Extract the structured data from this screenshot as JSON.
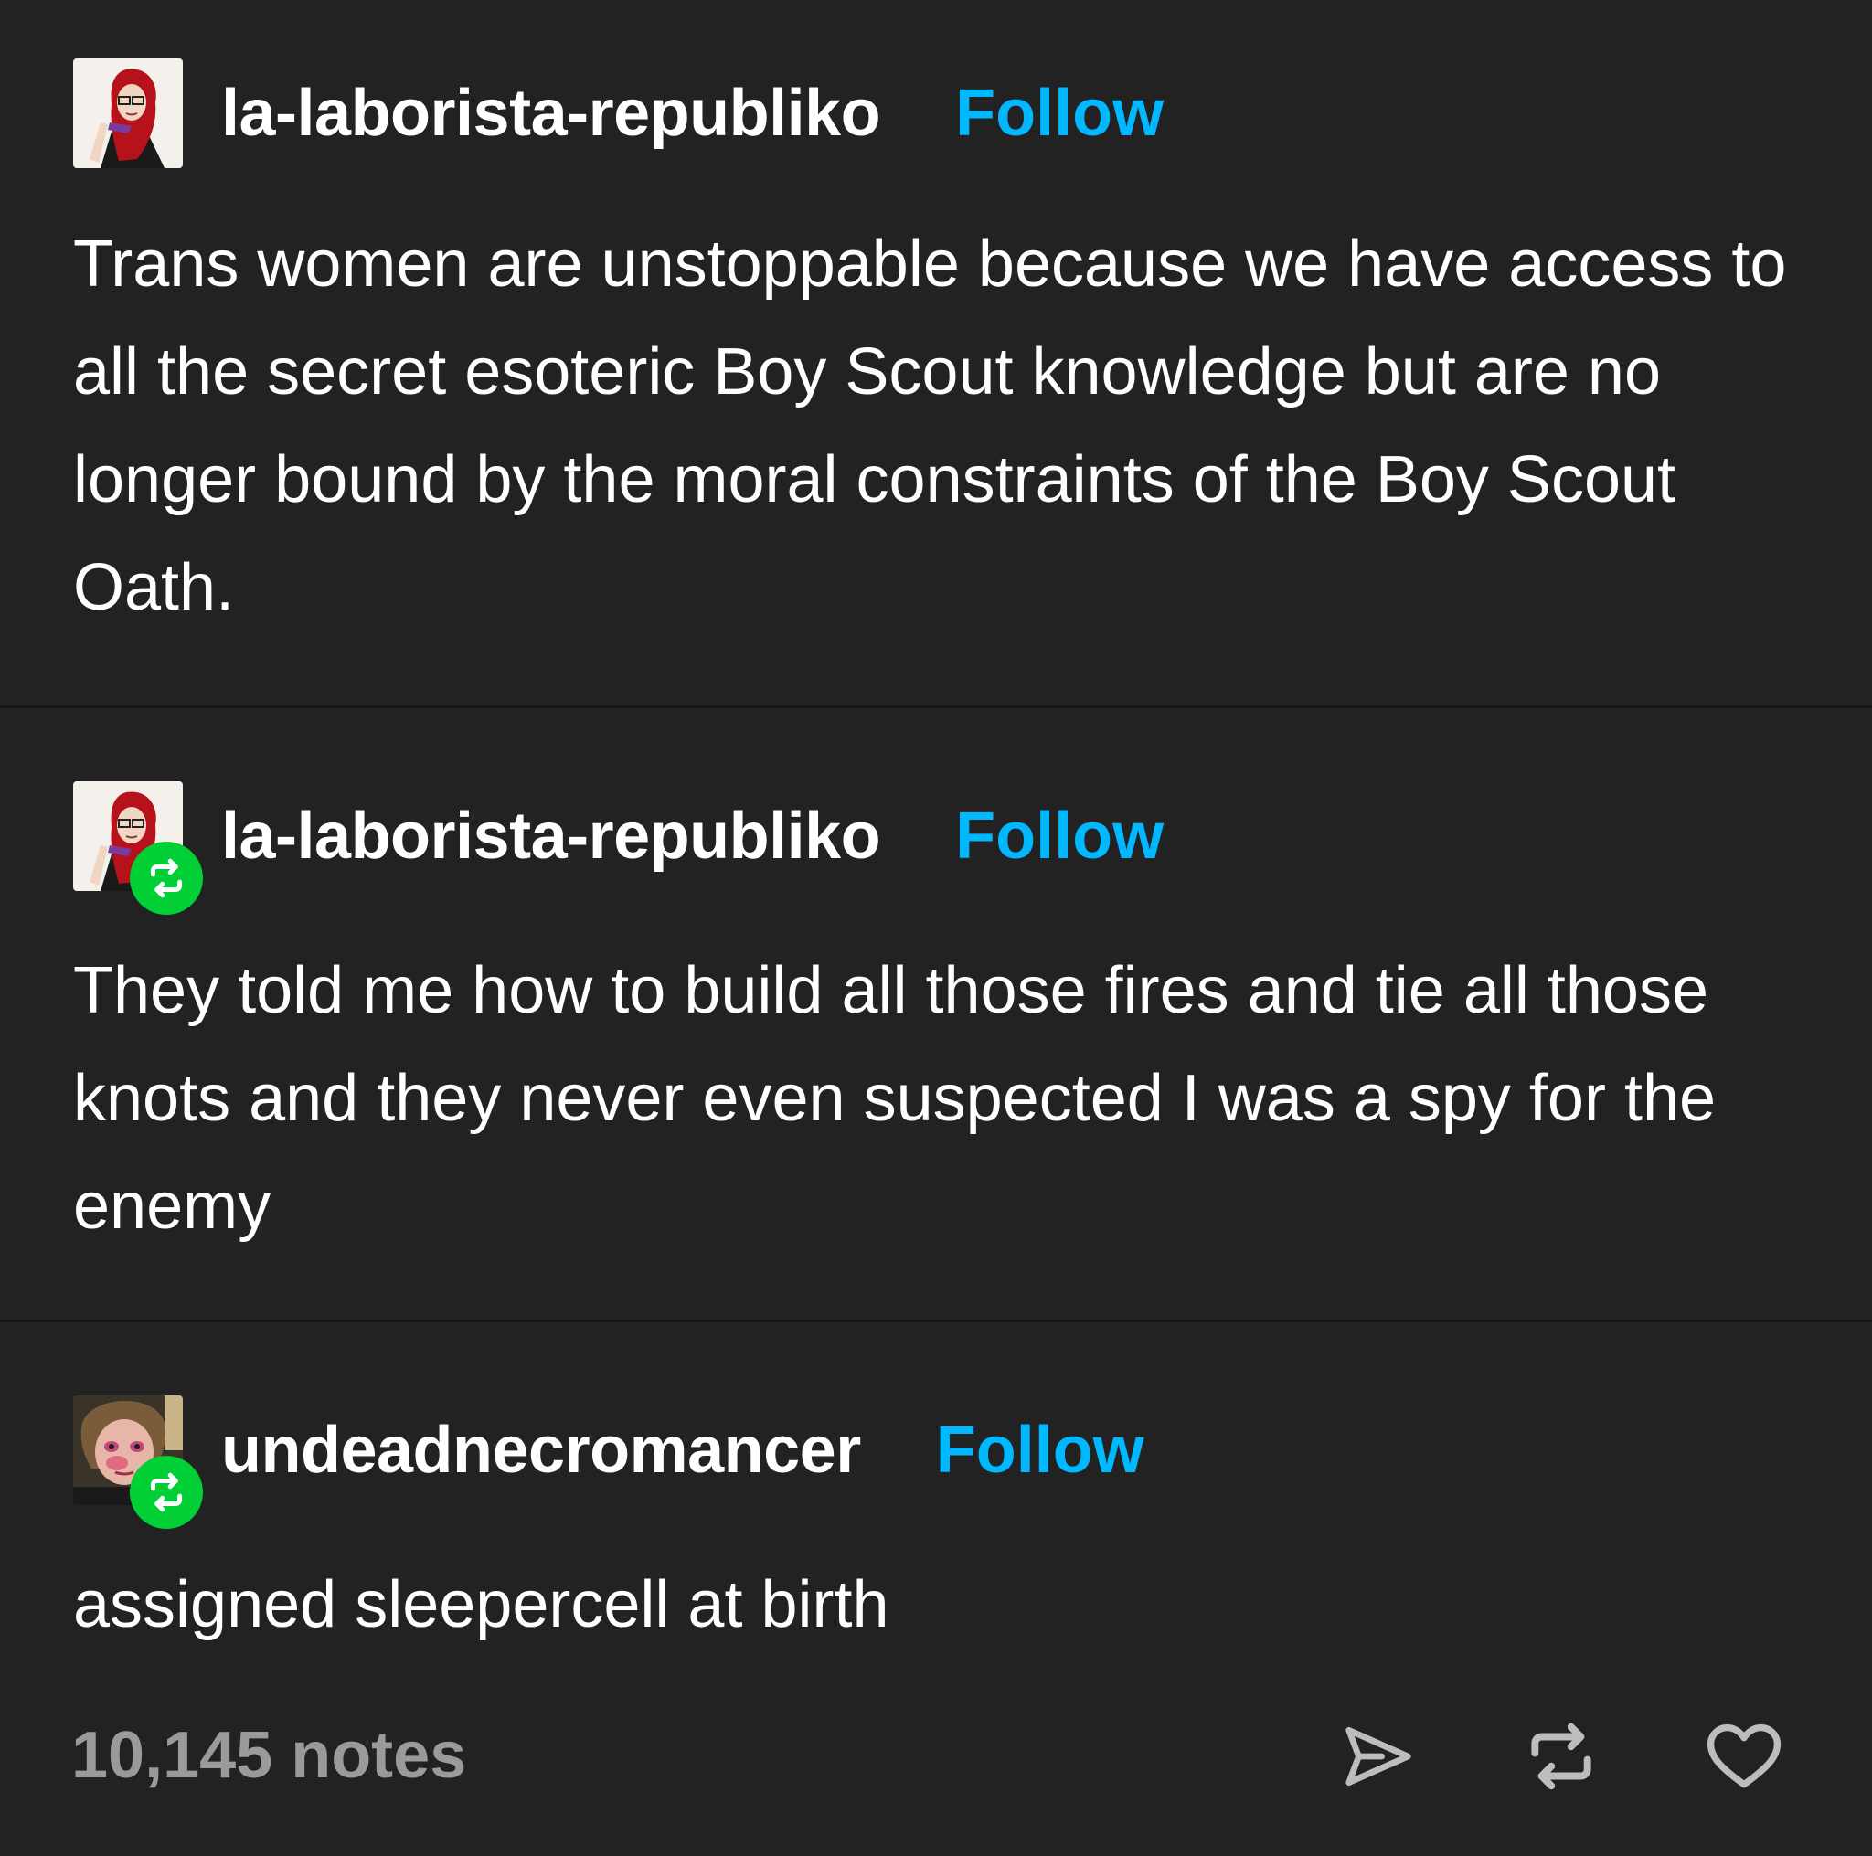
{
  "posts": [
    {
      "username": "la-laborista-republiko",
      "follow_label": "Follow",
      "avatar_icon": "avatar-red-hair-glasses",
      "reblogged": false,
      "text": "Trans women are unstoppable because we have access to all the secret esoteric Boy Scout knowledge but are no longer bound by the moral constraints of the Boy Scout Oath."
    },
    {
      "username": "la-laborista-republiko",
      "follow_label": "Follow",
      "avatar_icon": "avatar-red-hair-glasses",
      "reblogged": true,
      "text": "They told me how to build all those fires and tie all those knots and they never even suspected I was a spy for the enemy"
    },
    {
      "username": "undeadnecromancer",
      "follow_label": "Follow",
      "avatar_icon": "avatar-photo-person",
      "reblogged": true,
      "text": "assigned sleepercell at birth"
    }
  ],
  "footer": {
    "notes": "10,145 notes",
    "actions": [
      "share-icon",
      "reblog-icon",
      "heart-icon"
    ]
  },
  "colors": {
    "background": "#222222",
    "text": "#ffffff",
    "follow": "#00b8ff",
    "reblog_badge": "#00cf35",
    "notes": "#9a9a9a"
  }
}
